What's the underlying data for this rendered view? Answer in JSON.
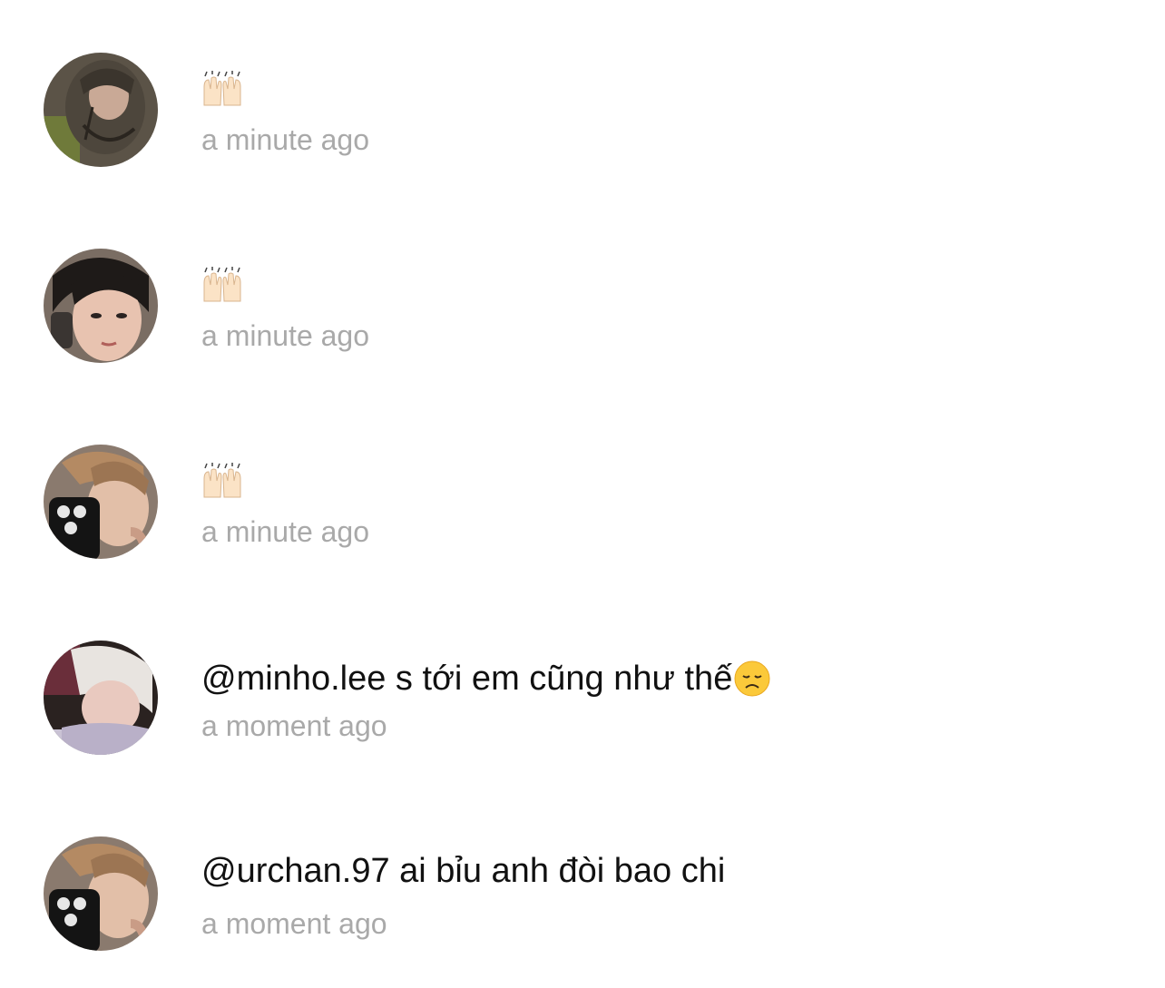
{
  "comments": [
    {
      "text": "",
      "emoji": "raising-hands-emoji",
      "time": "a minute ago",
      "avatar": "user-avatar-1"
    },
    {
      "text": "",
      "emoji": "raising-hands-emoji",
      "time": "a minute ago",
      "avatar": "user-avatar-2"
    },
    {
      "text": "",
      "emoji": "raising-hands-emoji",
      "time": "a minute ago",
      "avatar": "user-avatar-3"
    },
    {
      "text": "@minho.lee s tới em cũng như thế",
      "emoji": "disappointed-face-emoji",
      "time": "a moment ago",
      "avatar": "user-avatar-4"
    },
    {
      "text": "@urchan.97 ai bỉu anh đòi bao chi",
      "emoji": "",
      "time": "a moment ago",
      "avatar": "user-avatar-3"
    }
  ],
  "colors": {
    "text": "#111111",
    "timestamp": "#a9a9a9",
    "background": "#ffffff"
  }
}
